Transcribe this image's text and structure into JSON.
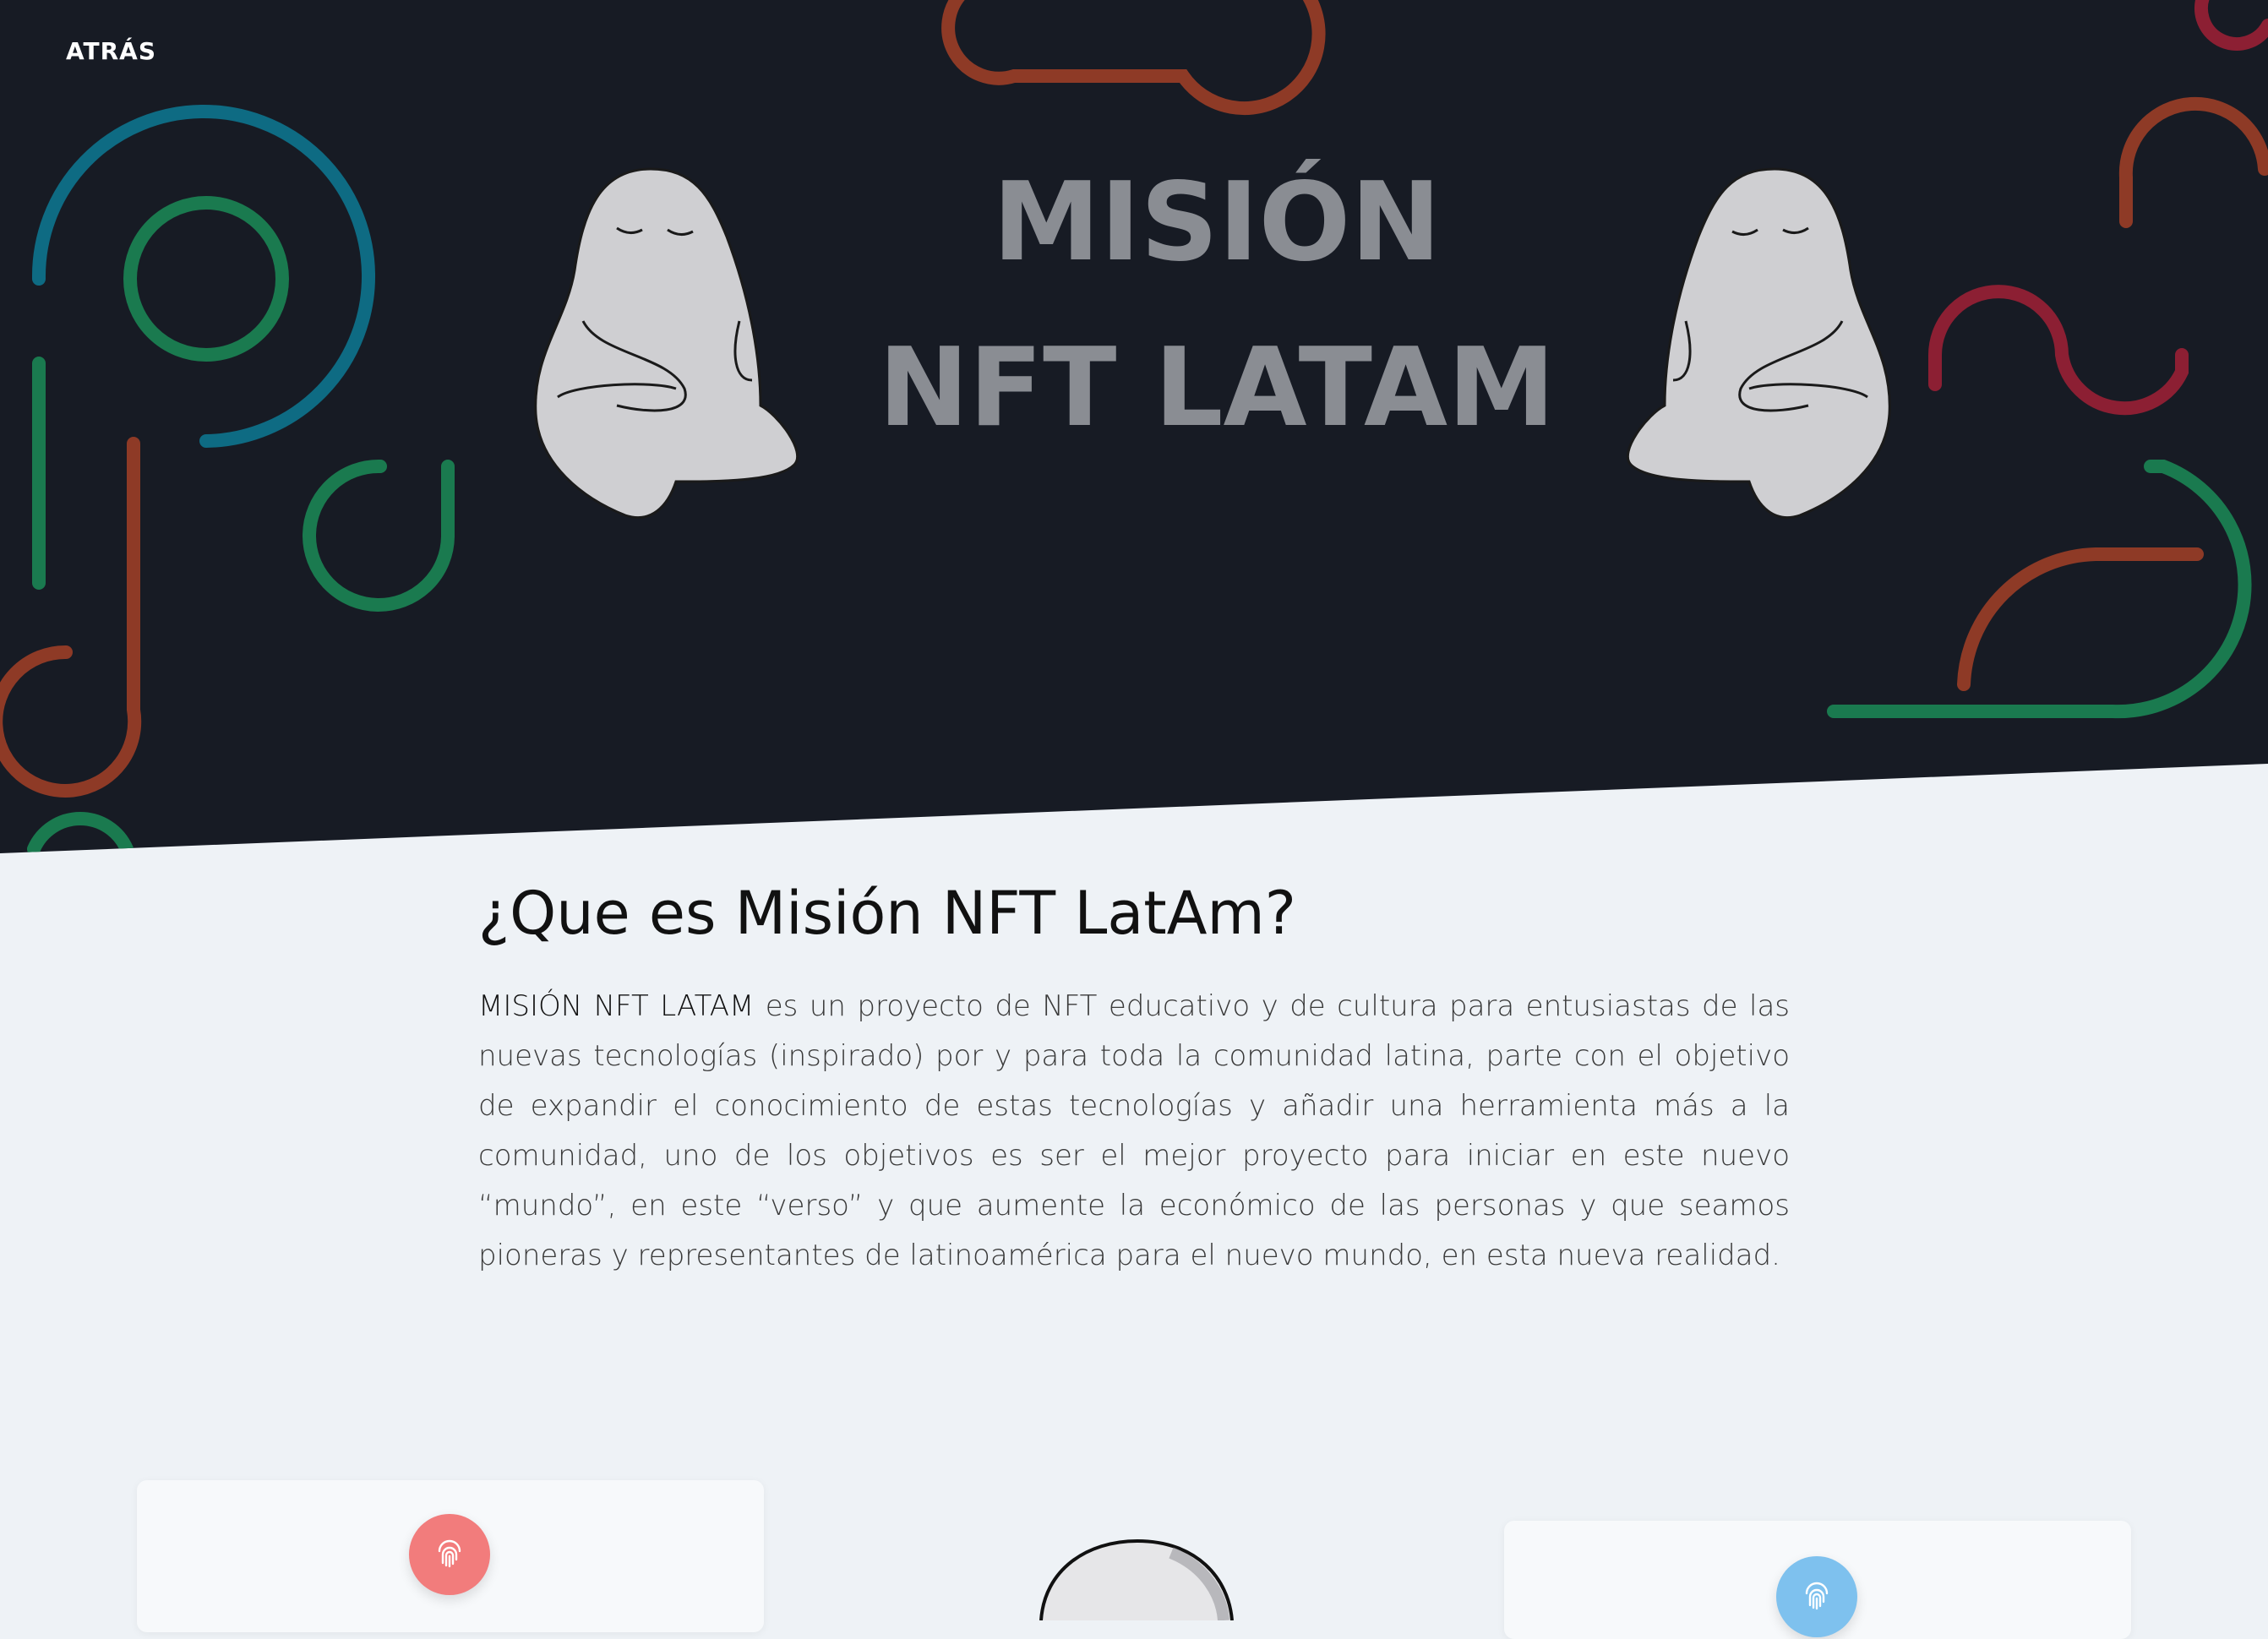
{
  "nav": {
    "back_label": "ATRÁS"
  },
  "hero": {
    "title_line1": "MISIÓN",
    "title_line2": "NFT LATAM",
    "colors": {
      "background": "#171b24",
      "title": "#8a8d93",
      "deco_blue": "#0e6b83",
      "deco_green": "#1a7a4f",
      "deco_orange": "#8e3a26",
      "deco_crimson": "#8c1f33"
    }
  },
  "about": {
    "heading": "¿Que es Misión NFT LatAm?",
    "lead": "MISIÓN NFT LATAM",
    "body": " es un proyecto de NFT educativo y de cultura para entusiastas de las nuevas tecnologías (inspirado) por y para toda la comunidad latina, parte con el objetivo de expandir el conocimiento de estas tecnologías y añadir una herramienta más a la comunidad, uno de los objetivos es ser el mejor proyecto para iniciar en este nuevo “mundo”, en este “verso” y que aumente la económico de las personas y que seamos pioneras y representantes de latinoamérica para el nuevo mundo, en esta nueva realidad."
  },
  "cards": [
    {
      "icon": "fingerprint-icon",
      "color": "#f27c7c"
    },
    {
      "icon": "fingerprint-icon",
      "color": "#7ec1ee"
    }
  ]
}
